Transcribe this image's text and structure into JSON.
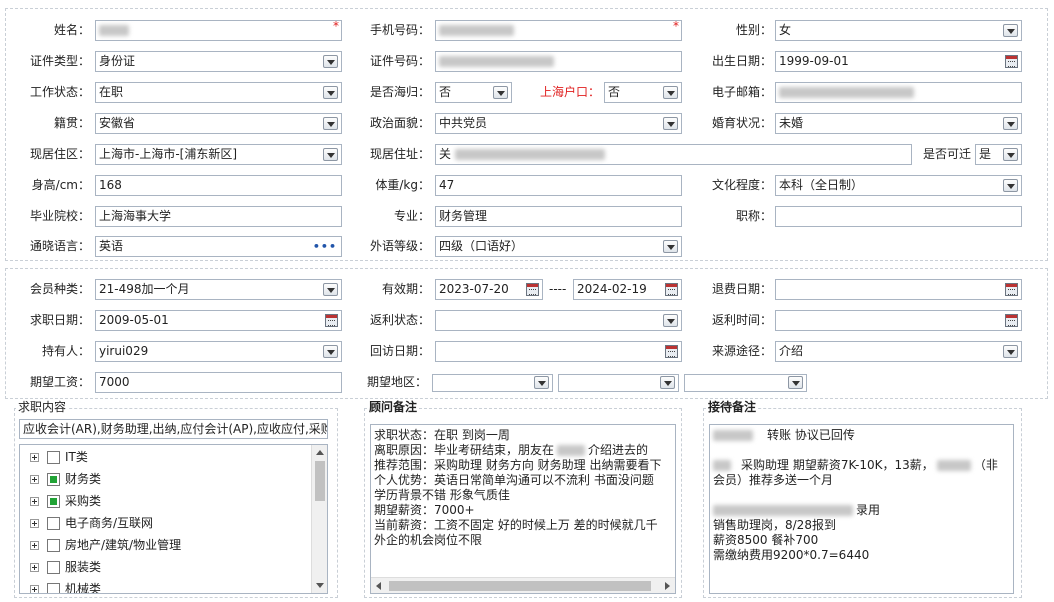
{
  "basic": {
    "name_label": "姓名：",
    "phone_label": "手机号码：",
    "gender_label": "性别：",
    "gender_value": "女",
    "idtype_label": "证件类型：",
    "idtype_value": "身份证",
    "idno_label": "证件号码：",
    "birth_label": "出生日期：",
    "birth_value": "1999-09-01",
    "workstatus_label": "工作状态：",
    "workstatus_value": "在职",
    "returnee_label": "是否海归：",
    "returnee_value": "否",
    "shhukou_label": "上海户口：",
    "shhukou_value": "否",
    "email_label": "电子邮箱：",
    "native_label": "籍贯：",
    "native_value": "安徽省",
    "political_label": "政治面貌：",
    "political_value": "中共党员",
    "marital_label": "婚育状况：",
    "marital_value": "未婚",
    "residence_label": "现居住区：",
    "residence_value": "上海市-上海市-[浦东新区]",
    "address_label": "现居住址：",
    "address_prefix": "关",
    "relocate_label": "是否可迁",
    "relocate_value": "是",
    "height_label": "身高/cm：",
    "height_value": "168",
    "weight_label": "体重/kg：",
    "weight_value": "47",
    "education_label": "文化程度：",
    "education_value": "本科（全日制）",
    "school_label": "毕业院校：",
    "school_value": "上海海事大学",
    "major_label": "专业：",
    "major_value": "财务管理",
    "title_label": "职称：",
    "title_value": "",
    "language_label": "通晓语言：",
    "language_value": "英语",
    "langlevel_label": "外语等级：",
    "langlevel_value": "四级（口语好）"
  },
  "member": {
    "type_label": "会员种类：",
    "type_value": "21-498加一个月",
    "validity_label": "有效期：",
    "valid_from": "2023-07-20",
    "valid_sep": "----",
    "valid_to": "2024-02-19",
    "refund_label": "退费日期：",
    "refund_value": "",
    "jobdate_label": "求职日期：",
    "jobdate_value": "2009-05-01",
    "rebate_status_label": "返利状态：",
    "rebate_status_value": "",
    "rebate_time_label": "返利时间：",
    "rebate_time_value": "",
    "holder_label": "持有人：",
    "holder_value": "yirui029",
    "revisit_label": "回访日期：",
    "revisit_value": "",
    "source_label": "来源途径：",
    "source_value": "介绍",
    "salary_label": "期望工资：",
    "salary_value": "7000",
    "area_label": "期望地区："
  },
  "job_content": {
    "title": "求职内容",
    "summary": "应收会计(AR),财务助理,出纳,应付会计(AP),应收应付,采购",
    "tree": [
      {
        "label": "IT类",
        "checked": false
      },
      {
        "label": "财务类",
        "checked": true
      },
      {
        "label": "采购类",
        "checked": true
      },
      {
        "label": "电子商务/互联网",
        "checked": false
      },
      {
        "label": "房地产/建筑/物业管理",
        "checked": false
      },
      {
        "label": "服装类",
        "checked": false
      },
      {
        "label": "机械类",
        "checked": false
      }
    ]
  },
  "advisor": {
    "title": "顾问备注",
    "lines": [
      "求职状态：在职 到岗一周",
      "离职原因：毕业考研结束，朋友在",
      "推荐范围：采购助理 财务方向 财务助理 出纳需要看下",
      "个人优势：英语日常简单沟通可以不流利 书面没问题",
      "学历背景不错 形象气质佳",
      "期望薪资：7000+",
      "当前薪资：工资不固定 好的时候上万 差的时候就几千",
      "外企的机会岗位不限"
    ],
    "line2_suffix": "介绍进去的"
  },
  "reception": {
    "title": "接待备注",
    "line1": "转账  协议已回传",
    "line2a": "采购助理   期望薪资7K-10K，13薪，",
    "line2b": "（非",
    "line3": "会员）推荐多送一个月",
    "line4": "录用",
    "line5": "销售助理岗，8/28报到",
    "line6": "薪资8500  餐补700",
    "line7": "需缴纳费用9200*0.7=6440"
  }
}
